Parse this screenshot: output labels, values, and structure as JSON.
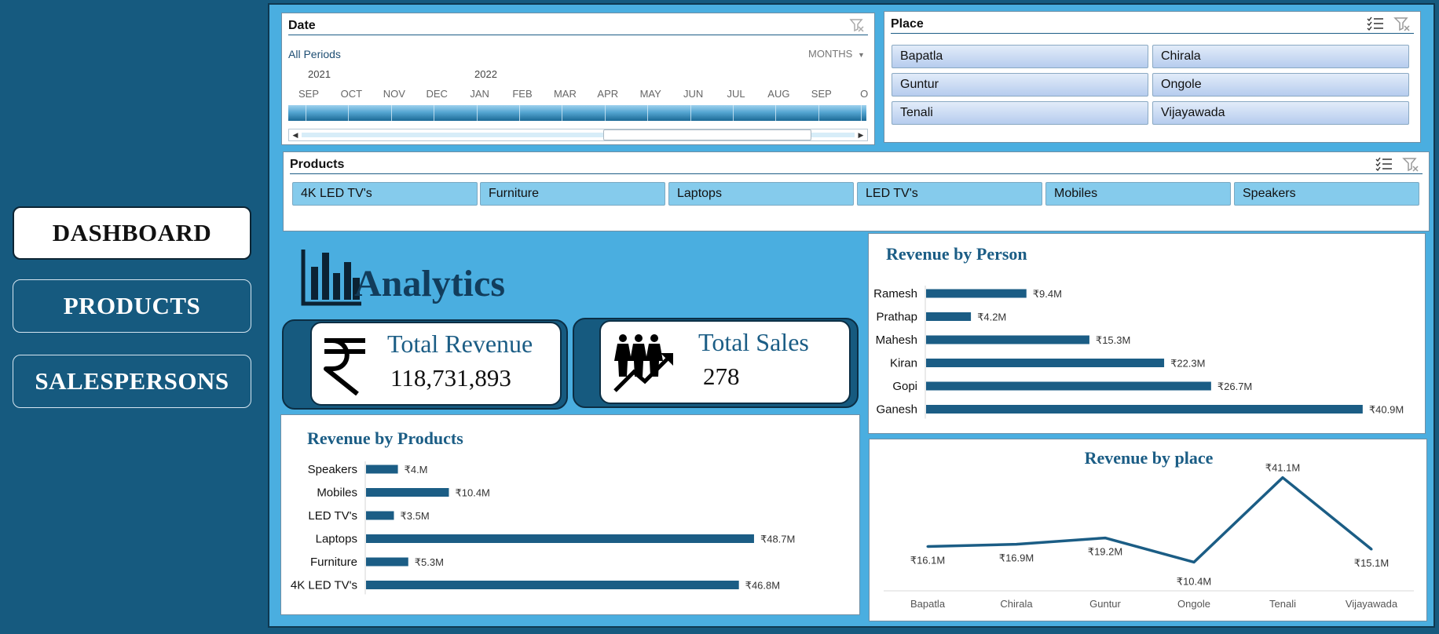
{
  "nav": {
    "dashboard": "DASHBOARD",
    "products": "PRODUCTS",
    "salespersons": "SALESPERSONS"
  },
  "date_slicer": {
    "title": "Date",
    "period_label": "All Periods",
    "level_label": "MONTHS",
    "years": [
      "2021",
      "2022"
    ],
    "months": [
      "SEP",
      "OCT",
      "NOV",
      "DEC",
      "JAN",
      "FEB",
      "MAR",
      "APR",
      "MAY",
      "JUN",
      "JUL",
      "AUG",
      "SEP",
      "O"
    ]
  },
  "place_slicer": {
    "title": "Place",
    "items": [
      "Bapatla",
      "Chirala",
      "Guntur",
      "Ongole",
      "Tenali",
      "Vijayawada"
    ]
  },
  "products_slicer": {
    "title": "Products",
    "items": [
      "4K LED TV's",
      "Furniture",
      "Laptops",
      "LED TV's",
      "Mobiles",
      "Speakers"
    ]
  },
  "analytics": {
    "title": "Analytics"
  },
  "kpis": {
    "revenue": {
      "label": "Total Revenue",
      "value": "118,731,893",
      "icon": "rupee-icon"
    },
    "sales": {
      "label": "Total Sales",
      "value": "278",
      "icon": "people-growth-icon"
    }
  },
  "colors": {
    "accent": "#165a7f",
    "background": "#4aaee0",
    "bar": "#1b5d85"
  },
  "chart_data": [
    {
      "type": "bar",
      "orientation": "horizontal",
      "title": "Revenue by Person",
      "categories": [
        "Ramesh",
        "Prathap",
        "Mahesh",
        "Kiran",
        "Gopi",
        "Ganesh"
      ],
      "values": [
        9.4,
        4.2,
        15.3,
        22.3,
        26.7,
        40.9
      ],
      "labels": [
        "₹9.4M",
        "₹4.2M",
        "₹15.3M",
        "₹22.3M",
        "₹26.7M",
        "₹40.9M"
      ],
      "xlim": [
        0,
        41.5
      ]
    },
    {
      "type": "bar",
      "orientation": "horizontal",
      "title": "Revenue by Products",
      "categories": [
        "Speakers",
        "Mobiles",
        "LED TV's",
        "Laptops",
        "Furniture",
        "4K LED TV's"
      ],
      "values": [
        4.0,
        10.4,
        3.5,
        48.7,
        5.3,
        46.8
      ],
      "labels": [
        "₹4.M",
        "₹10.4M",
        "₹3.5M",
        "₹48.7M",
        "₹5.3M",
        "₹46.8M"
      ],
      "xlim": [
        0,
        49
      ]
    },
    {
      "type": "line",
      "title": "Revenue by place",
      "categories": [
        "Bapatla",
        "Chirala",
        "Guntur",
        "Ongole",
        "Tenali",
        "Vijayawada"
      ],
      "values": [
        16.1,
        16.9,
        19.2,
        10.4,
        41.1,
        15.1
      ],
      "labels": [
        "₹16.1M",
        "₹16.9M",
        "₹19.2M",
        "₹10.4M",
        "₹41.1M",
        "₹15.1M"
      ],
      "ylim": [
        0,
        45
      ]
    }
  ]
}
